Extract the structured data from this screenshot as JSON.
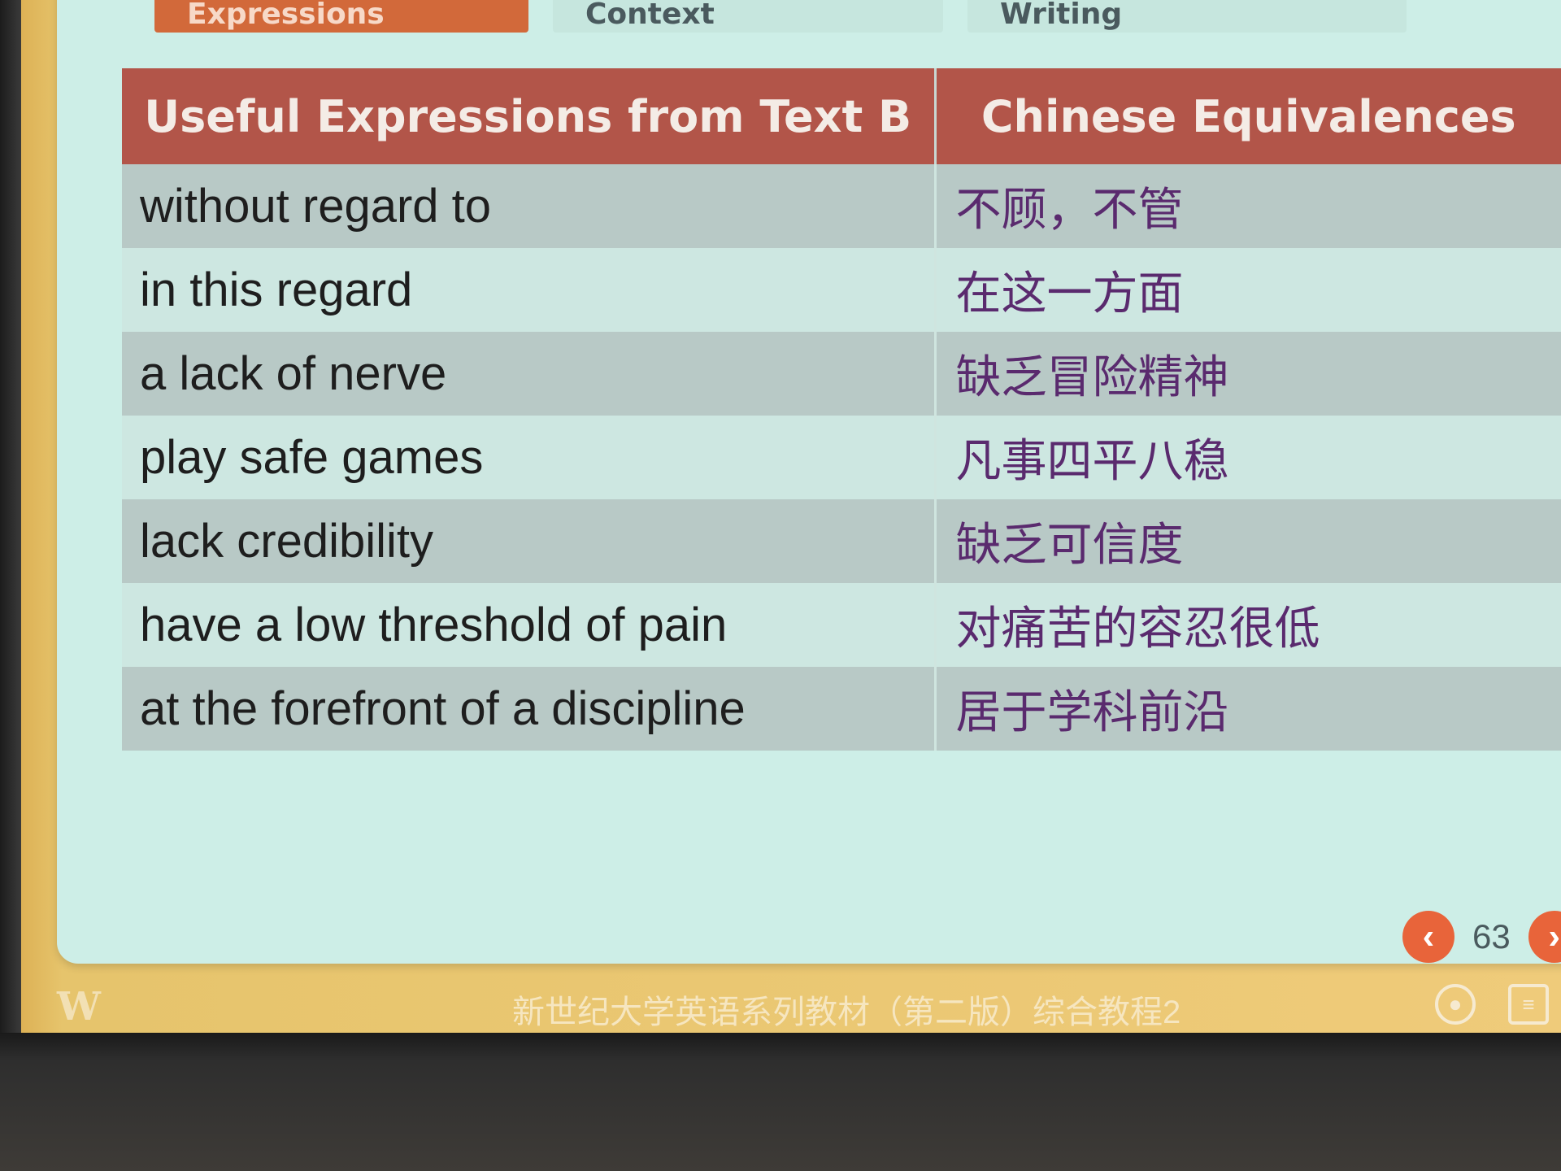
{
  "tabs": [
    {
      "label": "Useful Expressions",
      "active": true
    },
    {
      "label": "Grammar in Context",
      "active": false
    },
    {
      "label": "Theme-Related Writing",
      "active": false
    }
  ],
  "table": {
    "headers": [
      "Useful Expressions from Text B",
      "Chinese Equivalences"
    ],
    "rows": [
      {
        "en": "without regard to",
        "cn": "不顾，不管"
      },
      {
        "en": "in this regard",
        "cn": "在这一方面"
      },
      {
        "en": "a lack of nerve",
        "cn": "缺乏冒险精神"
      },
      {
        "en": "play safe games",
        "cn": "凡事四平八稳"
      },
      {
        "en": "lack credibility",
        "cn": "缺乏可信度"
      },
      {
        "en": "have a low threshold of pain",
        "cn": "对痛苦的容忍很低"
      },
      {
        "en": "at the forefront of a discipline",
        "cn": "居于学科前沿"
      }
    ]
  },
  "pager": {
    "prev_icon": "chevron-left-icon",
    "page": "63",
    "next_icon": "chevron-right-icon"
  },
  "footer": {
    "logo": "W",
    "title": "新世纪大学英语系列教材（第二版）综合教程2",
    "icons": [
      "user-icon",
      "notes-icon"
    ]
  },
  "colors": {
    "header_bg": "#b25549",
    "active_tab": "#d2693a",
    "accent": "#e8643a",
    "chinese_text": "#5a2a6e"
  }
}
